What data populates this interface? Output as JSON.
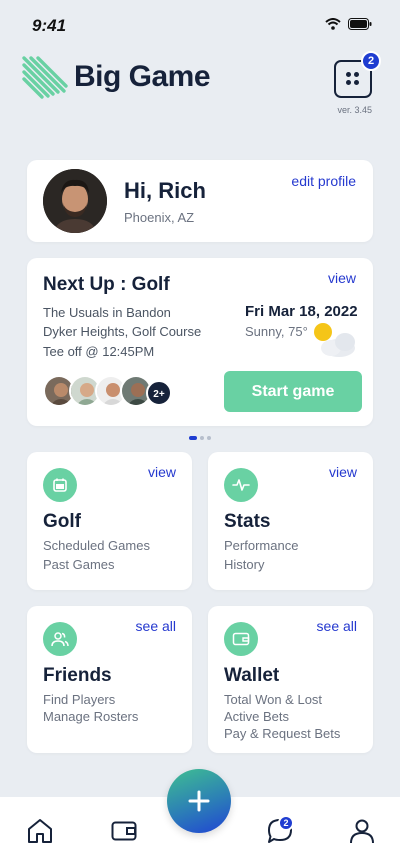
{
  "status": {
    "time": "9:41"
  },
  "header": {
    "brand": "Big Game",
    "menu_badge": "2",
    "version": "ver. 3.45"
  },
  "profile": {
    "greeting": "Hi, Rich",
    "location": "Phoenix, AZ",
    "edit_label": "edit profile"
  },
  "next_up": {
    "title": "Next Up : Golf",
    "view_label": "view",
    "group": "The Usuals in Bandon",
    "course": "Dyker Heights, Golf Course",
    "tee_off": "Tee off @ 12:45PM",
    "date": "Fri Mar 18, 2022",
    "weather": "Sunny, 75°",
    "extra_players": "2+",
    "start_label": "Start game"
  },
  "tiles": [
    {
      "title": "Golf",
      "link": "view",
      "lines": [
        "Scheduled Games",
        "Past Games"
      ],
      "icon": "calendar-icon"
    },
    {
      "title": "Stats",
      "link": "view",
      "lines": [
        "Performance",
        "History"
      ],
      "icon": "activity-icon"
    },
    {
      "title": "Friends",
      "link": "see all",
      "lines": [
        "Find Players",
        "Manage Rosters"
      ],
      "icon": "users-icon"
    },
    {
      "title": "Wallet",
      "link": "see all",
      "lines": [
        "Total Won & Lost",
        "Active Bets",
        "Pay & Request Bets"
      ],
      "icon": "wallet-icon"
    }
  ],
  "nav": {
    "chat_badge": "2",
    "items": [
      "home-icon",
      "wallet-icon",
      "add-icon",
      "chat-icon",
      "profile-icon"
    ]
  },
  "colors": {
    "accent_green": "#69d1a3",
    "brand_blue": "#1f3dd1",
    "navy": "#16223a"
  }
}
